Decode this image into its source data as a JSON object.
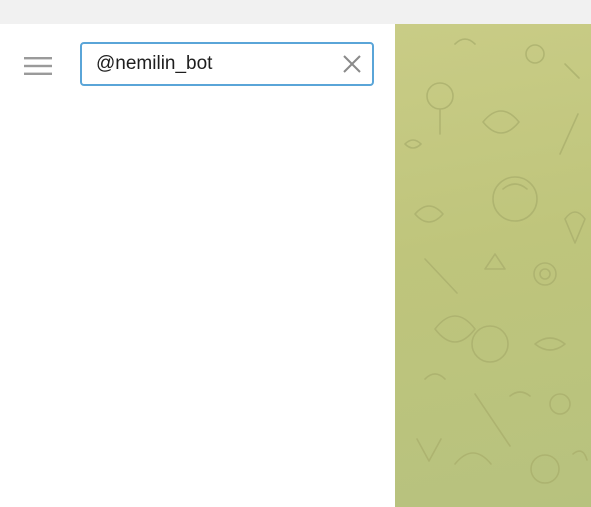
{
  "search": {
    "value": "@nemilin_bot",
    "clear_icon": "close-icon"
  },
  "menu": {
    "icon": "hamburger-menu-icon"
  },
  "colors": {
    "search_border": "#5aa5d8",
    "chat_background": "#c3c87f",
    "titlebar": "#f1f1f1"
  }
}
